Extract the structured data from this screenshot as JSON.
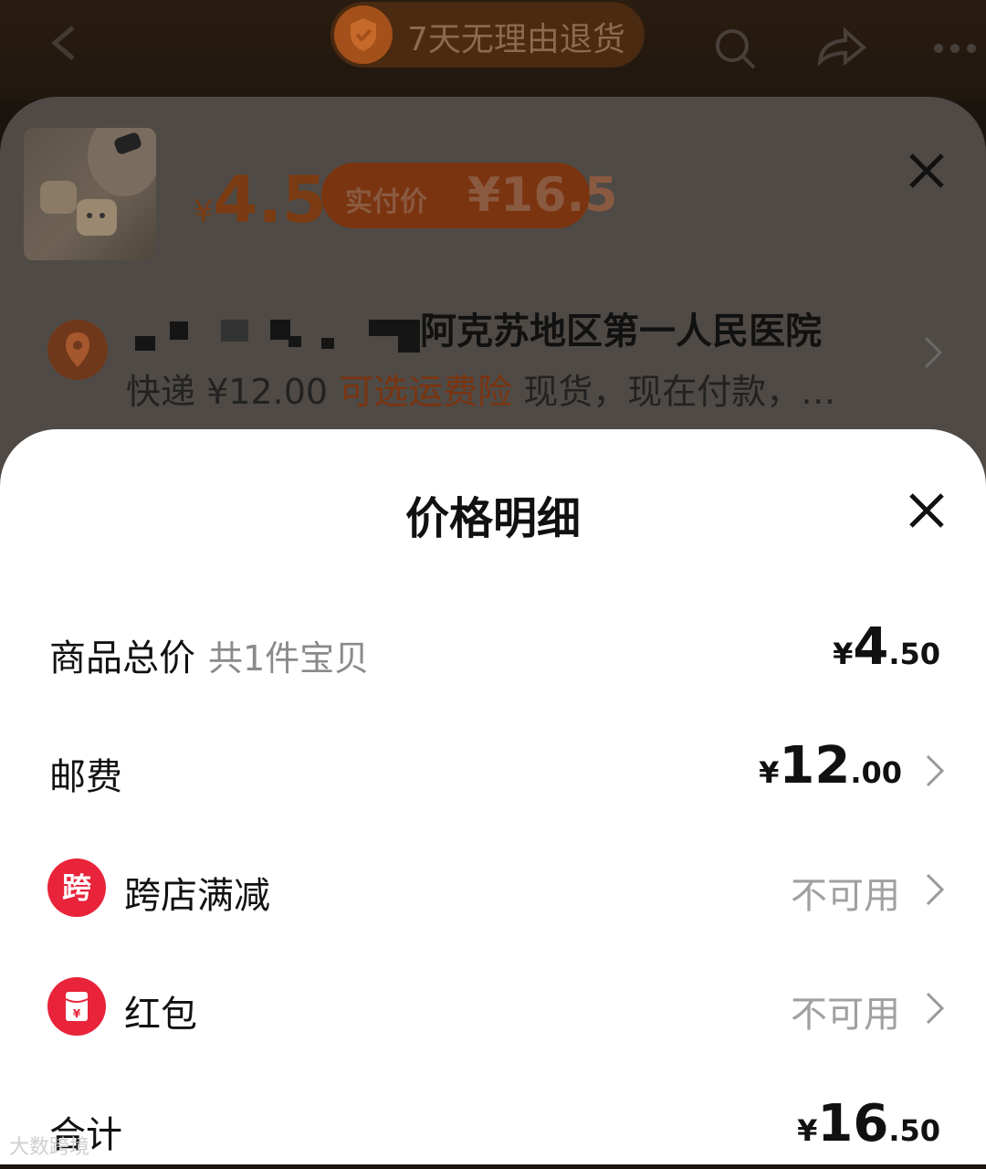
{
  "topbar": {
    "badge_text": "7天无理由退货"
  },
  "product": {
    "currency": "¥",
    "price": "4.5",
    "paid_label": "实付价",
    "paid_amount": "¥16.5"
  },
  "address": {
    "text": "阿克苏地区第一人民医院",
    "shipping_prefix": "快递 ¥12.00",
    "insurance": "可选运费险",
    "shipping_suffix": "现货，现在付款，…"
  },
  "sheet": {
    "title": "价格明细",
    "rows": [
      {
        "label": "商品总价",
        "sub": "共1件宝贝",
        "currency": "¥",
        "int": "4",
        "dec": ".50"
      },
      {
        "label": "邮费",
        "currency": "¥",
        "int": "12",
        "dec": ".00"
      },
      {
        "icon_text": "跨",
        "label": "跨店满减",
        "value": "不可用"
      },
      {
        "icon": "red-envelope-icon",
        "label": "红包",
        "value": "不可用"
      },
      {
        "label": "合计",
        "currency": "¥",
        "int": "16",
        "dec": ".50"
      }
    ]
  },
  "watermark": "大数跨境",
  "colors": {
    "accent": "#e8233a",
    "orange": "#ff5000"
  }
}
